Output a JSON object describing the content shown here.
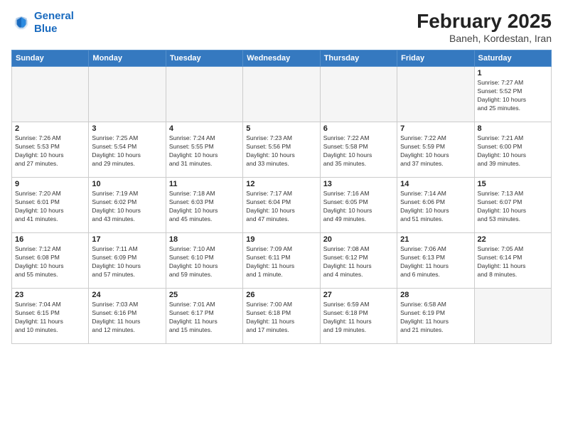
{
  "logo": {
    "line1": "General",
    "line2": "Blue"
  },
  "header": {
    "month_year": "February 2025",
    "location": "Baneh, Kordestan, Iran"
  },
  "weekdays": [
    "Sunday",
    "Monday",
    "Tuesday",
    "Wednesday",
    "Thursday",
    "Friday",
    "Saturday"
  ],
  "weeks": [
    [
      {
        "day": "",
        "info": ""
      },
      {
        "day": "",
        "info": ""
      },
      {
        "day": "",
        "info": ""
      },
      {
        "day": "",
        "info": ""
      },
      {
        "day": "",
        "info": ""
      },
      {
        "day": "",
        "info": ""
      },
      {
        "day": "1",
        "info": "Sunrise: 7:27 AM\nSunset: 5:52 PM\nDaylight: 10 hours\nand 25 minutes."
      }
    ],
    [
      {
        "day": "2",
        "info": "Sunrise: 7:26 AM\nSunset: 5:53 PM\nDaylight: 10 hours\nand 27 minutes."
      },
      {
        "day": "3",
        "info": "Sunrise: 7:25 AM\nSunset: 5:54 PM\nDaylight: 10 hours\nand 29 minutes."
      },
      {
        "day": "4",
        "info": "Sunrise: 7:24 AM\nSunset: 5:55 PM\nDaylight: 10 hours\nand 31 minutes."
      },
      {
        "day": "5",
        "info": "Sunrise: 7:23 AM\nSunset: 5:56 PM\nDaylight: 10 hours\nand 33 minutes."
      },
      {
        "day": "6",
        "info": "Sunrise: 7:22 AM\nSunset: 5:58 PM\nDaylight: 10 hours\nand 35 minutes."
      },
      {
        "day": "7",
        "info": "Sunrise: 7:22 AM\nSunset: 5:59 PM\nDaylight: 10 hours\nand 37 minutes."
      },
      {
        "day": "8",
        "info": "Sunrise: 7:21 AM\nSunset: 6:00 PM\nDaylight: 10 hours\nand 39 minutes."
      }
    ],
    [
      {
        "day": "9",
        "info": "Sunrise: 7:20 AM\nSunset: 6:01 PM\nDaylight: 10 hours\nand 41 minutes."
      },
      {
        "day": "10",
        "info": "Sunrise: 7:19 AM\nSunset: 6:02 PM\nDaylight: 10 hours\nand 43 minutes."
      },
      {
        "day": "11",
        "info": "Sunrise: 7:18 AM\nSunset: 6:03 PM\nDaylight: 10 hours\nand 45 minutes."
      },
      {
        "day": "12",
        "info": "Sunrise: 7:17 AM\nSunset: 6:04 PM\nDaylight: 10 hours\nand 47 minutes."
      },
      {
        "day": "13",
        "info": "Sunrise: 7:16 AM\nSunset: 6:05 PM\nDaylight: 10 hours\nand 49 minutes."
      },
      {
        "day": "14",
        "info": "Sunrise: 7:14 AM\nSunset: 6:06 PM\nDaylight: 10 hours\nand 51 minutes."
      },
      {
        "day": "15",
        "info": "Sunrise: 7:13 AM\nSunset: 6:07 PM\nDaylight: 10 hours\nand 53 minutes."
      }
    ],
    [
      {
        "day": "16",
        "info": "Sunrise: 7:12 AM\nSunset: 6:08 PM\nDaylight: 10 hours\nand 55 minutes."
      },
      {
        "day": "17",
        "info": "Sunrise: 7:11 AM\nSunset: 6:09 PM\nDaylight: 10 hours\nand 57 minutes."
      },
      {
        "day": "18",
        "info": "Sunrise: 7:10 AM\nSunset: 6:10 PM\nDaylight: 10 hours\nand 59 minutes."
      },
      {
        "day": "19",
        "info": "Sunrise: 7:09 AM\nSunset: 6:11 PM\nDaylight: 11 hours\nand 1 minute."
      },
      {
        "day": "20",
        "info": "Sunrise: 7:08 AM\nSunset: 6:12 PM\nDaylight: 11 hours\nand 4 minutes."
      },
      {
        "day": "21",
        "info": "Sunrise: 7:06 AM\nSunset: 6:13 PM\nDaylight: 11 hours\nand 6 minutes."
      },
      {
        "day": "22",
        "info": "Sunrise: 7:05 AM\nSunset: 6:14 PM\nDaylight: 11 hours\nand 8 minutes."
      }
    ],
    [
      {
        "day": "23",
        "info": "Sunrise: 7:04 AM\nSunset: 6:15 PM\nDaylight: 11 hours\nand 10 minutes."
      },
      {
        "day": "24",
        "info": "Sunrise: 7:03 AM\nSunset: 6:16 PM\nDaylight: 11 hours\nand 12 minutes."
      },
      {
        "day": "25",
        "info": "Sunrise: 7:01 AM\nSunset: 6:17 PM\nDaylight: 11 hours\nand 15 minutes."
      },
      {
        "day": "26",
        "info": "Sunrise: 7:00 AM\nSunset: 6:18 PM\nDaylight: 11 hours\nand 17 minutes."
      },
      {
        "day": "27",
        "info": "Sunrise: 6:59 AM\nSunset: 6:18 PM\nDaylight: 11 hours\nand 19 minutes."
      },
      {
        "day": "28",
        "info": "Sunrise: 6:58 AM\nSunset: 6:19 PM\nDaylight: 11 hours\nand 21 minutes."
      },
      {
        "day": "",
        "info": ""
      }
    ]
  ]
}
